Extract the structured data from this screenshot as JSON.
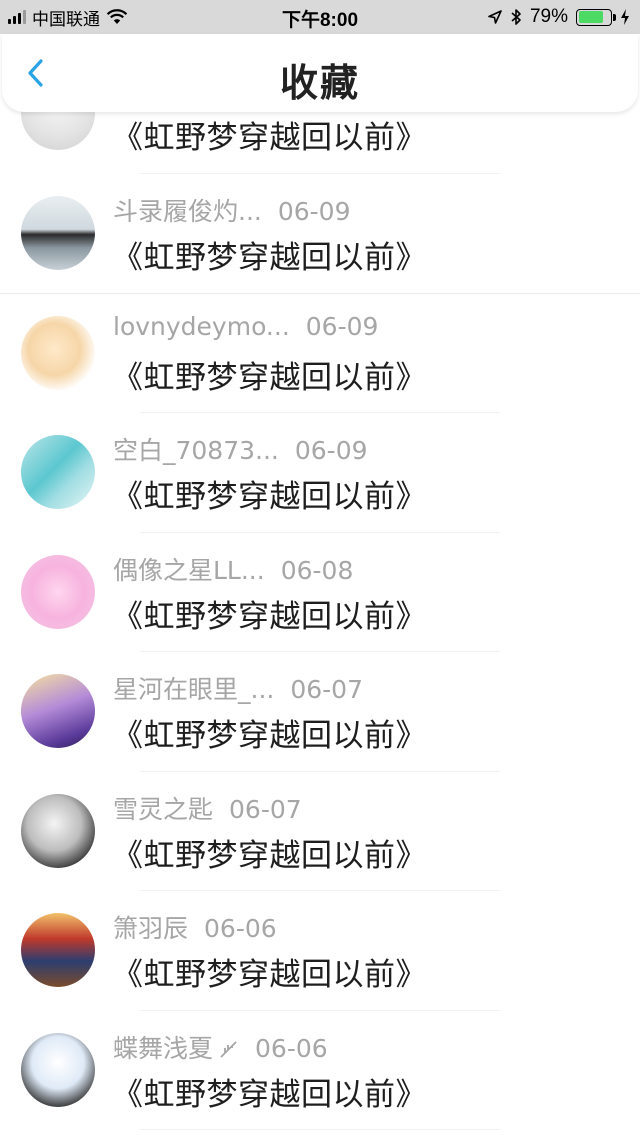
{
  "status_bar": {
    "carrier": "中国联通",
    "time": "下午8:00",
    "battery_percent_label": "79%",
    "battery_level": 0.79,
    "icons": [
      "signal-icon",
      "wifi-icon",
      "location-icon",
      "bluetooth-icon",
      "battery-icon",
      "charging-icon"
    ]
  },
  "nav": {
    "title": "收藏",
    "back_icon": "chevron-left-icon",
    "accent_color": "#2aa3e6"
  },
  "items": [
    {
      "user": "",
      "date": "",
      "title": "《虹野梦穿越回以前》"
    },
    {
      "user": "斗录履俊灼...",
      "date": "06-09",
      "title": "《虹野梦穿越回以前》"
    },
    {
      "user": "lovnydeymo...",
      "date": "06-09",
      "title": "《虹野梦穿越回以前》"
    },
    {
      "user": "空白_70873...",
      "date": "06-09",
      "title": "《虹野梦穿越回以前》"
    },
    {
      "user": "偶像之星LL...",
      "date": "06-08",
      "title": "《虹野梦穿越回以前》"
    },
    {
      "user": "星河在眼里_...",
      "date": "06-07",
      "title": "《虹野梦穿越回以前》"
    },
    {
      "user": "雪灵之匙",
      "date": "06-07",
      "title": "《虹野梦穿越回以前》"
    },
    {
      "user": "箫羽辰",
      "date": "06-06",
      "title": "《虹野梦穿越回以前》"
    },
    {
      "user": "蝶舞浅夏",
      "date": "06-06",
      "title": "《虹野梦穿越回以前》"
    }
  ]
}
